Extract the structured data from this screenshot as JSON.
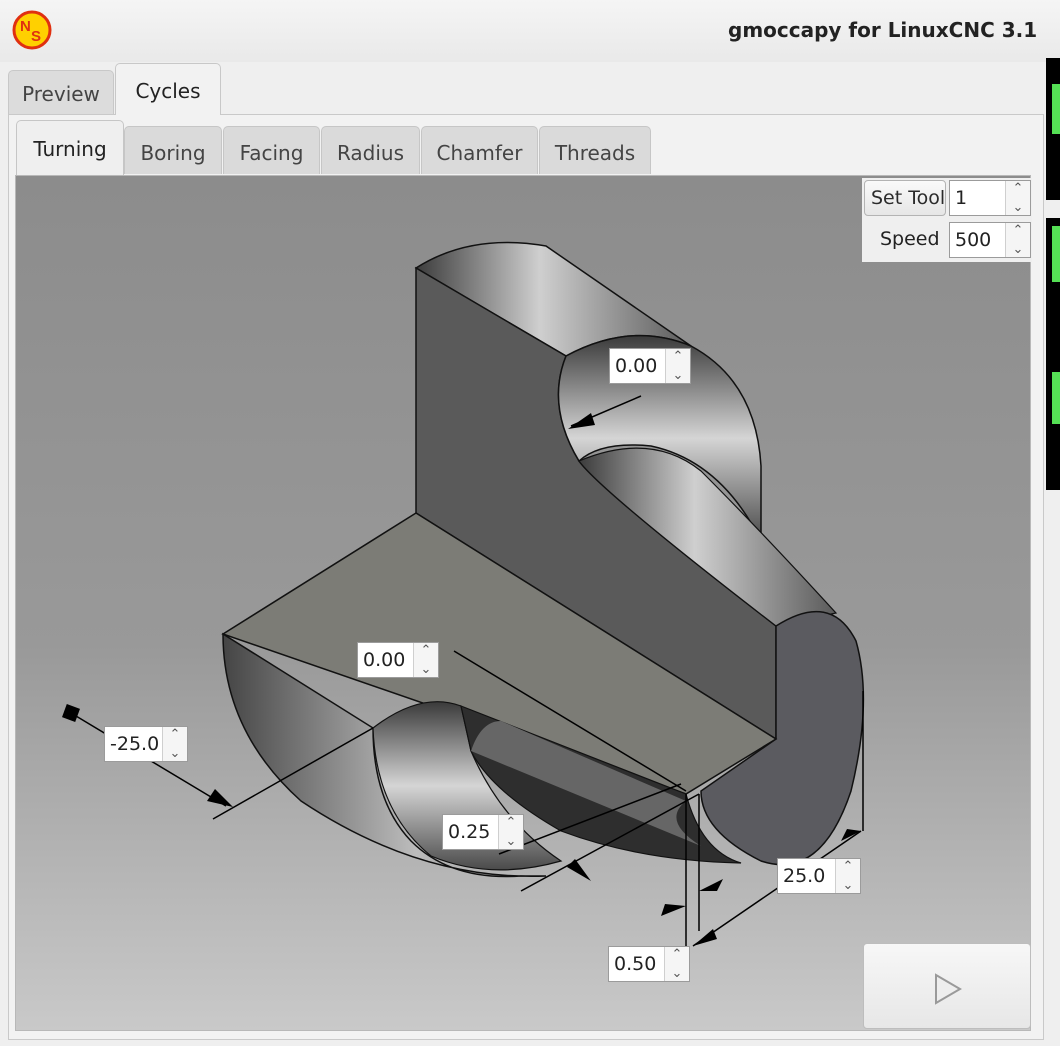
{
  "window": {
    "title": "gmoccapy for LinuxCNC  3.1"
  },
  "outer_tabs": [
    {
      "label": "Preview"
    },
    {
      "label": "Cycles"
    }
  ],
  "cycle_tabs": [
    {
      "label": "Turning"
    },
    {
      "label": "Boring"
    },
    {
      "label": "Facing"
    },
    {
      "label": "Radius"
    },
    {
      "label": "Chamfer"
    },
    {
      "label": "Threads"
    }
  ],
  "settings": {
    "set_tool_label": "Set Tool",
    "tool_value": "1",
    "speed_label": "Speed",
    "speed_value": "500"
  },
  "parameters": {
    "radius_top": "0.00",
    "depth_center": "0.00",
    "start_z": "-25.0",
    "depth_cut": "0.25",
    "end_z": "25.0",
    "finish_allowance": "0.50"
  },
  "colors": {
    "dro_green": "#55e055"
  },
  "icons": {
    "logo": "ns-logo-icon",
    "run": "play-icon"
  }
}
